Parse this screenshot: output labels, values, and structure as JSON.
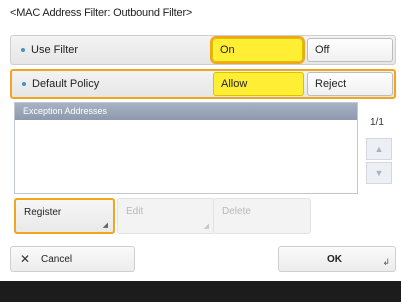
{
  "title": "<MAC Address Filter: Outbound Filter>",
  "use_filter": {
    "label": "Use Filter",
    "options": [
      "On",
      "Off"
    ],
    "selected": "On"
  },
  "default_policy": {
    "label": "Default Policy",
    "options": [
      "Allow",
      "Reject"
    ],
    "selected": "Allow"
  },
  "exception_list": {
    "header": "Exception Addresses",
    "items": [],
    "page_indicator": "1/1"
  },
  "actions": {
    "register": "Register",
    "edit": "Edit",
    "delete": "Delete"
  },
  "footer": {
    "cancel": "Cancel",
    "ok": "OK"
  },
  "colors": {
    "selected": "#ffee33",
    "focus_outline": "#f2a51d",
    "list_header": "#98a3b7"
  },
  "icons": {
    "up": "triangle-up",
    "down": "triangle-down",
    "cancel": "x-mark",
    "ok": "enter-arrow"
  }
}
